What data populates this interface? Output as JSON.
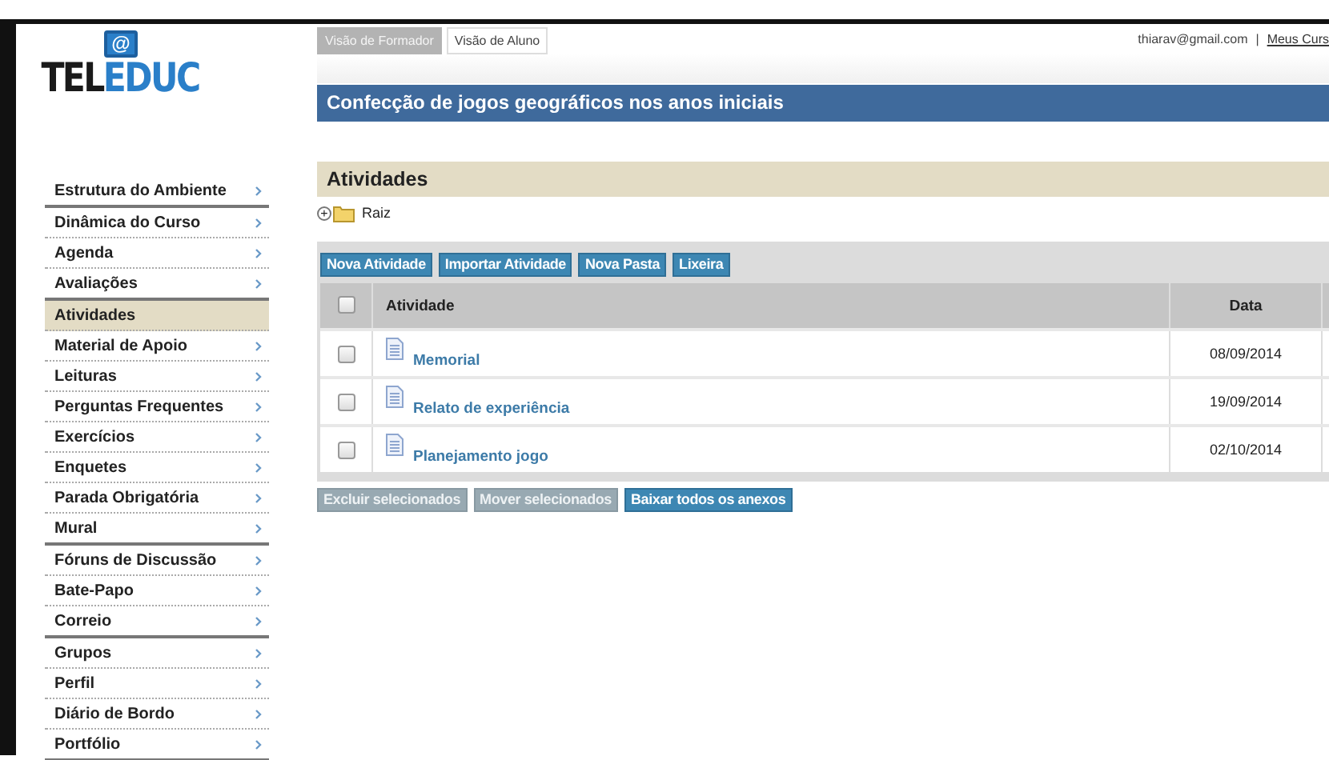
{
  "logo": {
    "top": "@",
    "left": "TEL",
    "right": "EDUC"
  },
  "view_tabs": [
    {
      "label": "Visão de Formador",
      "selected": true
    },
    {
      "label": "Visão de Aluno",
      "selected": false
    }
  ],
  "user": {
    "email": "thiarav@gmail.com",
    "separator": "|",
    "link": "Meus Curs"
  },
  "course_title": "Confecção de jogos geográficos nos anos iniciais",
  "sidebar": {
    "groups": [
      {
        "items": [
          {
            "label": "Estrutura do Ambiente",
            "selected": false
          }
        ]
      },
      {
        "items": [
          {
            "label": "Dinâmica do Curso",
            "selected": false
          },
          {
            "label": "Agenda",
            "selected": false
          },
          {
            "label": "Avaliações",
            "selected": false
          }
        ]
      },
      {
        "items": [
          {
            "label": "Atividades",
            "selected": true
          },
          {
            "label": "Material de Apoio",
            "selected": false
          },
          {
            "label": "Leituras",
            "selected": false
          },
          {
            "label": "Perguntas Frequentes",
            "selected": false
          },
          {
            "label": "Exercícios",
            "selected": false
          },
          {
            "label": "Enquetes",
            "selected": false
          },
          {
            "label": "Parada Obrigatória",
            "selected": false
          },
          {
            "label": "Mural",
            "selected": false
          }
        ]
      },
      {
        "items": [
          {
            "label": "Fóruns de Discussão",
            "selected": false
          },
          {
            "label": "Bate-Papo",
            "selected": false
          },
          {
            "label": "Correio",
            "selected": false
          }
        ]
      },
      {
        "items": [
          {
            "label": "Grupos",
            "selected": false
          },
          {
            "label": "Perfil",
            "selected": false
          },
          {
            "label": "Diário de Bordo",
            "selected": false
          },
          {
            "label": "Portfólio",
            "selected": false
          }
        ]
      }
    ]
  },
  "section_title": "Atividades",
  "breadcrumb": {
    "expand": "+",
    "label": "Raiz"
  },
  "toolbar": [
    {
      "label": "Nova Atividade",
      "disabled": false
    },
    {
      "label": "Importar Atividade",
      "disabled": false
    },
    {
      "label": "Nova Pasta",
      "disabled": false
    },
    {
      "label": "Lixeira",
      "disabled": false
    }
  ],
  "table": {
    "header_checked": false,
    "columns": [
      "Atividade",
      "Data"
    ],
    "rows": [
      {
        "checked": false,
        "name": "Memorial",
        "date": "08/09/2014"
      },
      {
        "checked": false,
        "name": "Relato de experiência",
        "date": "19/09/2014"
      },
      {
        "checked": false,
        "name": "Planejamento jogo",
        "date": "02/10/2014"
      }
    ]
  },
  "actions": [
    {
      "label": "Excluir selecionados",
      "disabled": true
    },
    {
      "label": "Mover selecionados",
      "disabled": true
    },
    {
      "label": "Baixar todos os anexos",
      "disabled": false
    }
  ]
}
